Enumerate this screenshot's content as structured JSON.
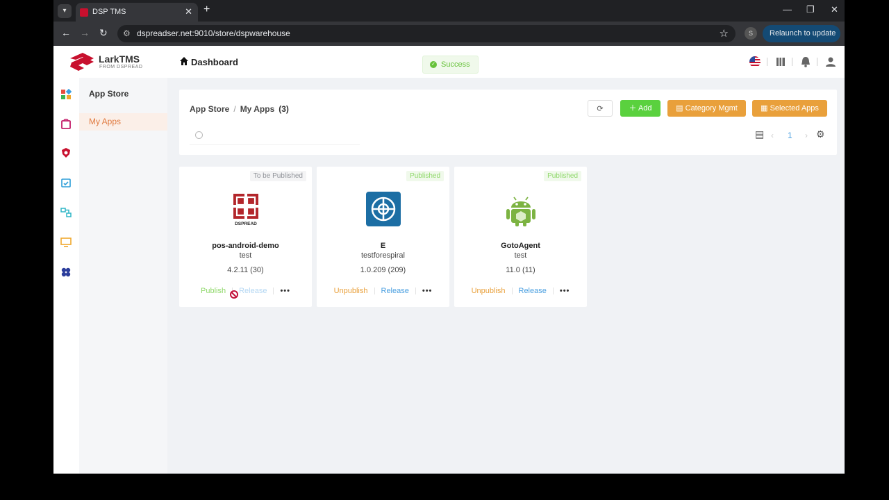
{
  "browser": {
    "tab_title": "DSP TMS",
    "url": "dspreadser.net:9010/store/dspwarehouse",
    "profile_initial": "S",
    "relaunch_label": "Relaunch to update"
  },
  "header": {
    "logo_text": "LarkTMS",
    "logo_sub": "FROM DSPREAD",
    "title": "Dashboard",
    "toast": "Success",
    "icons": [
      "us-flag-icon",
      "book-icon",
      "bell-icon",
      "user-icon"
    ]
  },
  "sidebar": {
    "rail_icons": [
      "apps-grid-icon",
      "shopping-bag-icon",
      "shield-icon",
      "calendar-check-icon",
      "flow-icon",
      "monitor-icon",
      "clover-icon"
    ],
    "section_title": "App Store",
    "active_item": "My Apps"
  },
  "main": {
    "breadcrumb": [
      "App Store",
      "My Apps"
    ],
    "count": "(3)",
    "buttons": {
      "add": "Add",
      "category": "Category Mgmt",
      "selected": "Selected Apps"
    },
    "search_placeholder": "",
    "page": "1"
  },
  "apps": [
    {
      "badge": "To be Published",
      "name": "pos-android-demo",
      "desc": "test",
      "version": "4.2.11   (30)",
      "primary_action": "Publish",
      "release": "Release"
    },
    {
      "badge": "Published",
      "name": "E",
      "desc": "testforespiral",
      "version": "1.0.209   (209)",
      "primary_action": "Unpublish",
      "release": "Release"
    },
    {
      "badge": "Published",
      "name": "GotoAgent",
      "desc": "test",
      "version": "11.0   (11)",
      "primary_action": "Unpublish",
      "release": "Release"
    }
  ],
  "colors": {
    "accent_orange": "#e9a03b",
    "green": "#5ad13e",
    "brand_red": "#c8102e"
  }
}
